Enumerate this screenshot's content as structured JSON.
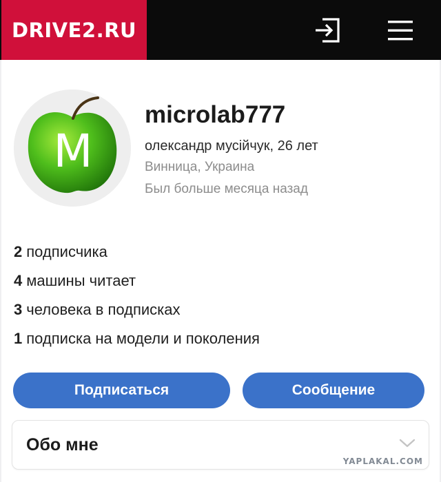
{
  "header": {
    "logo": "DRIVE2.RU",
    "login_icon": "login-icon",
    "menu_icon": "hamburger-menu-icon",
    "colors": {
      "logo_bg": "#d0103a",
      "header_bg": "#0b0b0b"
    }
  },
  "profile": {
    "avatar_letter": "M",
    "avatar_image": "green-apple",
    "username": "microlab777",
    "full_name": "олександр мусійчук, 26 лет",
    "location": "Винница, Украина",
    "last_seen": "Был больше месяца назад"
  },
  "stats": [
    {
      "count": "2",
      "label": "подписчика"
    },
    {
      "count": "4",
      "label": "машины читает"
    },
    {
      "count": "3",
      "label": "человека в подписках"
    },
    {
      "count": "1",
      "label": "подписка на модели и поколения"
    }
  ],
  "actions": {
    "subscribe_label": "Подписаться",
    "message_label": "Сообщение",
    "button_color": "#3b72c9"
  },
  "about": {
    "title": "Обо мне",
    "chevron_icon": "chevron-down-icon"
  },
  "watermark": "YAPLAKAL.COM"
}
